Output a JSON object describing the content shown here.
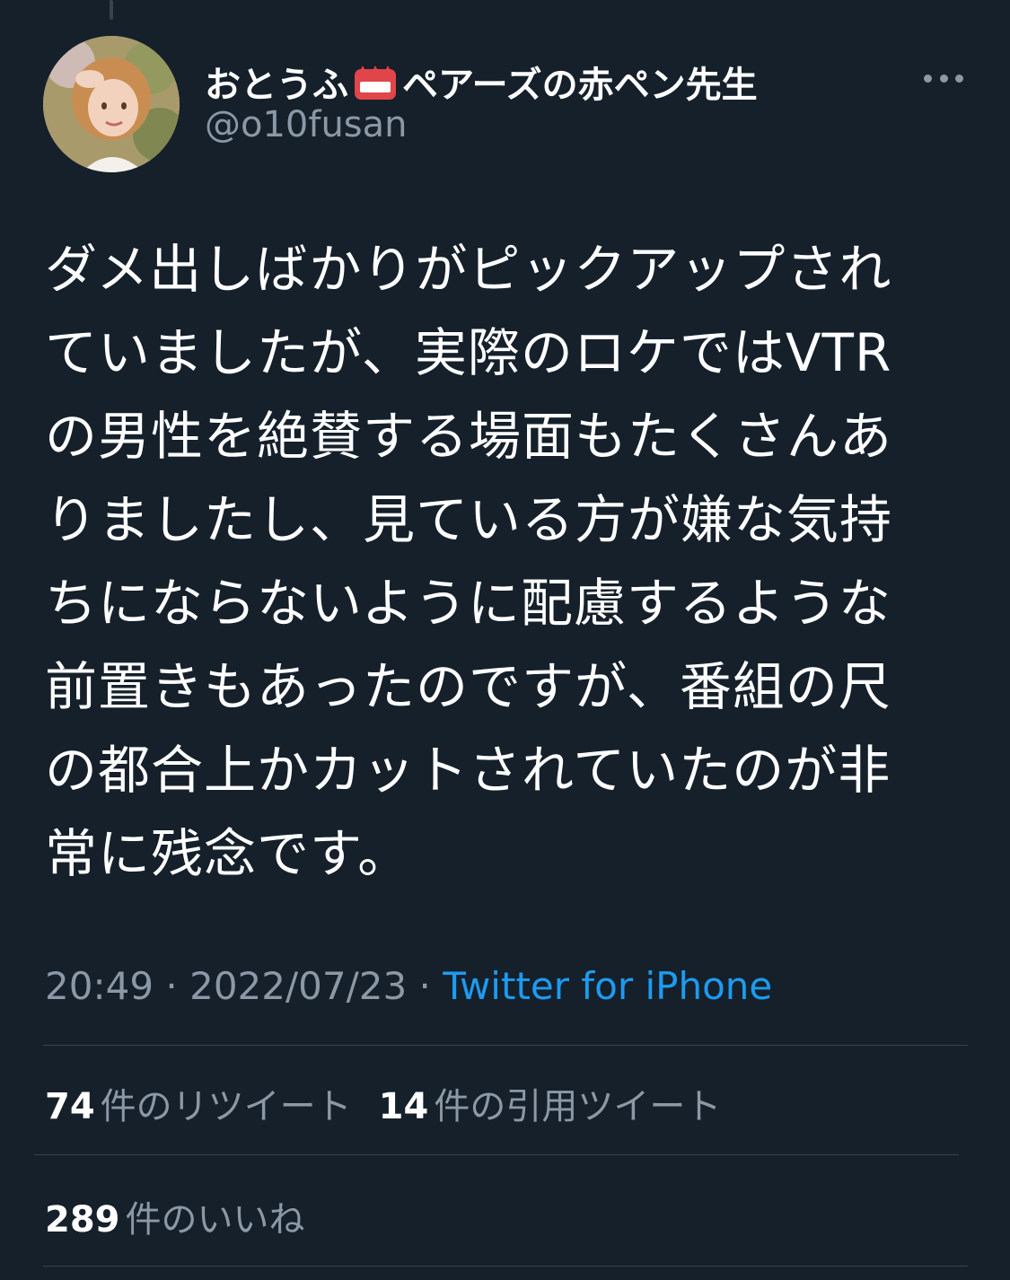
{
  "author": {
    "display_name_prefix": "おとうふ",
    "badge_icon": "red-pen-crown-icon",
    "display_name_suffix": "ペアーズの赤ペン先生",
    "handle": "@o10fusan"
  },
  "tweet": {
    "lines": [
      "ダメ出しばかりがピックアップされ",
      "ていましたが、実際のロケではVTR",
      "の男性を絶賛する場面もたくさんあ",
      "りましたし、見ている方が嫌な気持",
      "ちにならないように配慮するような",
      "前置きもあったのですが、番組の尺",
      "の都合上かカットされていたのが非",
      "常に残念です。"
    ]
  },
  "meta": {
    "time": "20:49",
    "separator": " · ",
    "date": "2022/07/23",
    "source": "Twitter for iPhone"
  },
  "stats": {
    "retweets_count": "74",
    "retweets_label": "件のリツイート",
    "quotes_count": "14",
    "quotes_label": "件の引用ツイート",
    "likes_count": "289",
    "likes_label": "件のいいね"
  },
  "colors": {
    "background": "#15202b",
    "secondary_text": "#8b98a5",
    "link": "#1d9bf0",
    "divider": "#38444d"
  }
}
